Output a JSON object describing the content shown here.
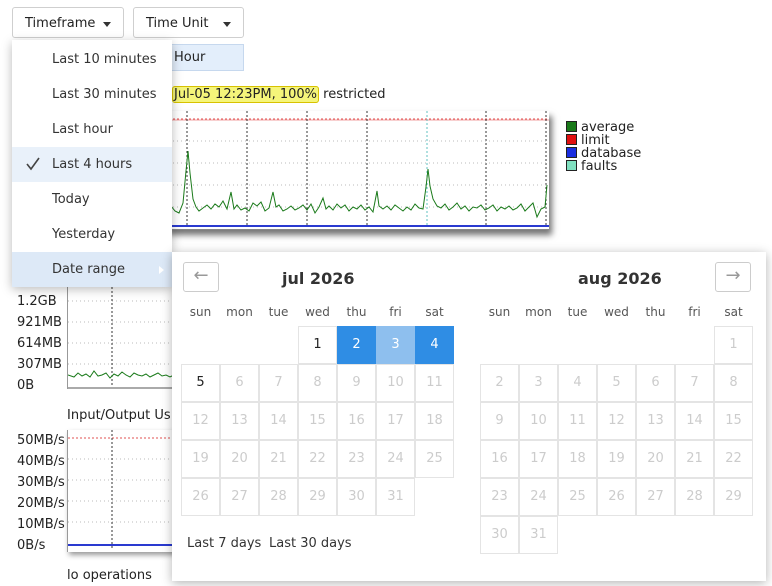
{
  "toolbar": {
    "timeframe_label": "Timeframe",
    "timeunit_label": "Time Unit",
    "hour_label": "Hour"
  },
  "status": {
    "highlight": "Jul-05 12:23PM, 100%",
    "suffix": "restricted"
  },
  "legend": [
    {
      "label": "average",
      "color": "#1a7a1a"
    },
    {
      "label": "limit",
      "color": "#e01010"
    },
    {
      "label": "database",
      "color": "#1a2ee0"
    },
    {
      "label": "faults",
      "color": "#80e0c0"
    }
  ],
  "memory_axis": [
    "1.2GB",
    "921MB",
    "614MB",
    "307MB",
    "0B"
  ],
  "io_title": "Input/Output Us",
  "io_axis": [
    "50MB/s",
    "40MB/s",
    "30MB/s",
    "20MB/s",
    "10MB/s",
    "0B/s"
  ],
  "bottom_title": "lo operations",
  "timeframe_menu": [
    {
      "label": "Last 10 minutes"
    },
    {
      "label": "Last 30 minutes"
    },
    {
      "label": "Last hour"
    },
    {
      "label": "Last 4 hours",
      "checked": true
    },
    {
      "label": "Today"
    },
    {
      "label": "Yesterday"
    },
    {
      "label": "Date range",
      "submenu": true
    }
  ],
  "picker": {
    "prev_arrow": "←",
    "next_arrow": "→",
    "months": [
      {
        "title": "jul 2026",
        "weekdays": [
          "sun",
          "mon",
          "tue",
          "wed",
          "thu",
          "fri",
          "sat"
        ],
        "weeks": [
          [
            "",
            "",
            "",
            "1",
            "2",
            "3",
            "4"
          ],
          [
            "5",
            "6",
            "7",
            "8",
            "9",
            "10",
            "11"
          ],
          [
            "12",
            "13",
            "14",
            "15",
            "16",
            "17",
            "18"
          ],
          [
            "19",
            "20",
            "21",
            "22",
            "23",
            "24",
            "25"
          ],
          [
            "26",
            "27",
            "28",
            "29",
            "30",
            "31",
            ""
          ]
        ]
      },
      {
        "title": "aug 2026",
        "weekdays": [
          "sun",
          "mon",
          "tue",
          "wed",
          "thu",
          "fri",
          "sat"
        ],
        "weeks": [
          [
            "",
            "",
            "",
            "",
            "",
            "",
            "1"
          ],
          [
            "2",
            "3",
            "4",
            "5",
            "6",
            "7",
            "8"
          ],
          [
            "9",
            "10",
            "11",
            "12",
            "13",
            "14",
            "15"
          ],
          [
            "16",
            "17",
            "18",
            "19",
            "20",
            "21",
            "22"
          ],
          [
            "23",
            "24",
            "25",
            "26",
            "27",
            "28",
            "29"
          ],
          [
            "30",
            "31",
            "",
            "",
            "",
            "",
            ""
          ]
        ]
      }
    ],
    "selected_start": "2",
    "selected_end": "4",
    "quick_ranges": [
      "Last 7 days",
      "Last 30 days"
    ]
  }
}
